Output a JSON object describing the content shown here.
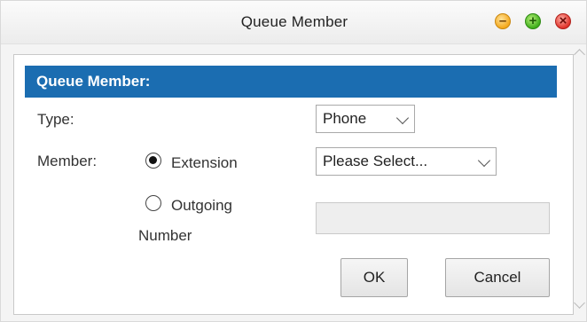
{
  "window": {
    "title": "Queue Member",
    "minimize_icon": "minimize-icon",
    "maximize_icon": "maximize-icon",
    "close_icon": "close-icon",
    "minimize_glyph": "–",
    "maximize_glyph": "+",
    "close_glyph": "×"
  },
  "form": {
    "section_title": "Queue Member:",
    "type_label": "Type:",
    "type_value": "Phone",
    "member_label": "Member:",
    "extension_option": "Extension",
    "extension_selected": true,
    "extension_select_value": "Please Select...",
    "outgoing_option_line1": "Outgoing",
    "outgoing_option_line2": "Number",
    "outgoing_selected": false,
    "outgoing_number_value": ""
  },
  "buttons": {
    "ok_label": "OK",
    "cancel_label": "Cancel"
  },
  "colors": {
    "header_bg": "#1b6db1",
    "header_text": "#ffffff"
  }
}
